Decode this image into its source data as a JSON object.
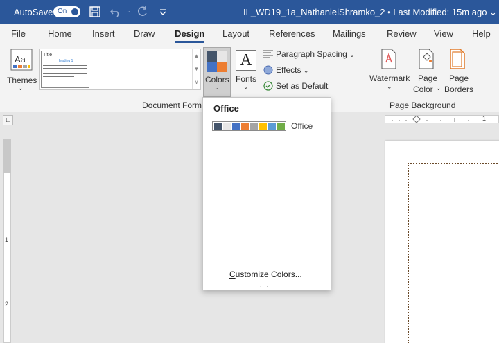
{
  "titlebar": {
    "autosave_label": "AutoSave",
    "autosave_state": "On",
    "document_title": "IL_WD19_1a_NathanielShramko_2 • Last Modified: 15m ago ⌄"
  },
  "tabs": [
    "File",
    "Home",
    "Insert",
    "Draw",
    "Design",
    "Layout",
    "References",
    "Mailings",
    "Review",
    "View",
    "Help"
  ],
  "active_tab": "Design",
  "ribbon": {
    "themes_label": "Themes",
    "gallery_thumb": {
      "title": "Title",
      "heading": "Heading 1"
    },
    "colors_label": "Colors",
    "fonts_label": "Fonts",
    "fonts_glyph": "A",
    "paragraph_spacing": "Paragraph Spacing",
    "effects": "Effects",
    "set_as_default": "Set as Default",
    "group_document_formatting": "Document Forma",
    "watermark": "Watermark",
    "page_color_1": "Page",
    "page_color_2": "Color",
    "page_borders_1": "Page",
    "page_borders_2": "Borders",
    "group_page_background": "Page Background"
  },
  "ruler": {
    "h_number": "1",
    "v_numbers": [
      "1",
      "2"
    ]
  },
  "colors_dropdown": {
    "section_header": "Office",
    "items": [
      {
        "name": "Office",
        "colors": [
          "#44546a",
          "#e7e6e6",
          "#4472c4",
          "#ed7d31",
          "#a5a5a5",
          "#ffc000",
          "#5b9bd5",
          "#70ad47"
        ]
      }
    ],
    "customize_label_prefix": "C",
    "customize_label_rest": "ustomize Colors...",
    "grip": "...."
  },
  "colors_button_swatch": [
    "#44546a",
    "#e7e6e6",
    "#4472c4",
    "#ed7d31"
  ]
}
